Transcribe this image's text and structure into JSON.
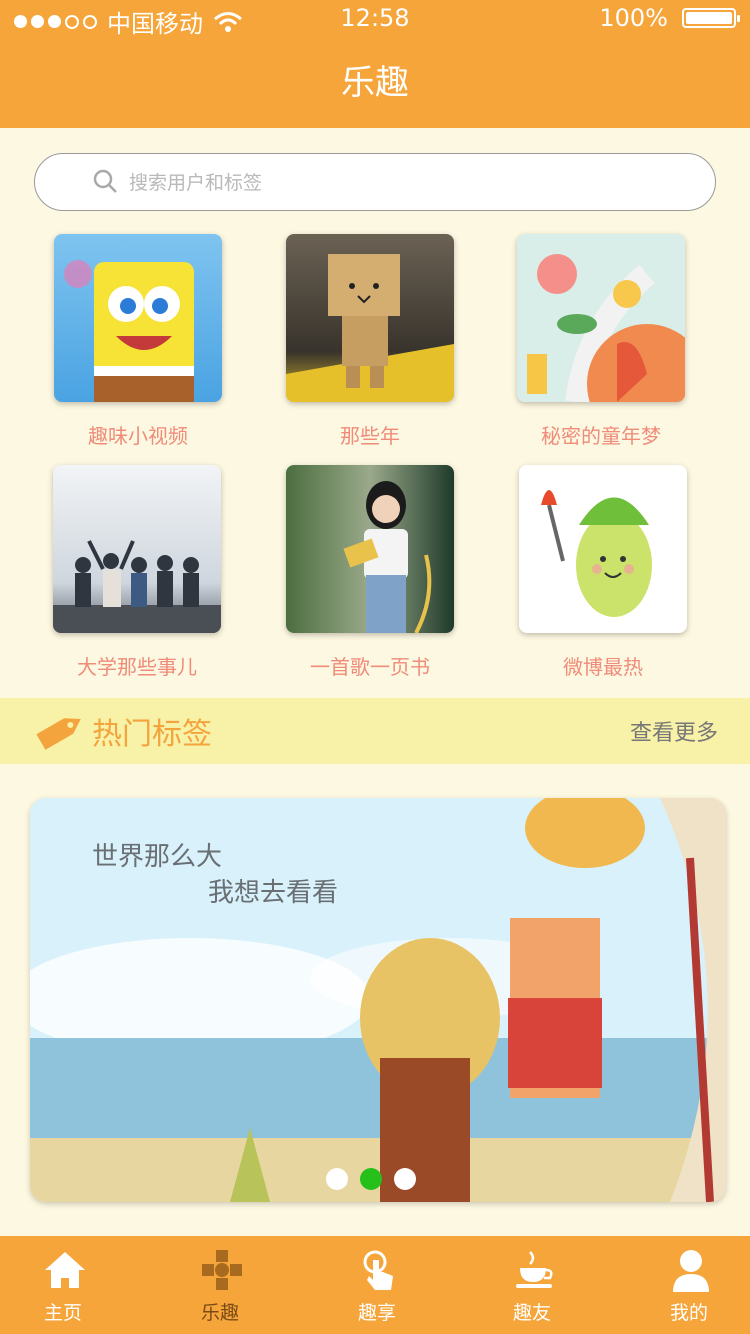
{
  "status_bar": {
    "carrier": "中国移动",
    "time": "12:58",
    "battery": "100%",
    "signal_icon": "signal-dots-icon",
    "wifi_icon": "wifi-icon",
    "battery_level": 1.0
  },
  "header": {
    "title": "乐趣"
  },
  "search": {
    "placeholder": "搜索用户和标签",
    "icon": "search-icon"
  },
  "categories": [
    {
      "label": "趣味小视频"
    },
    {
      "label": "那些年"
    },
    {
      "label": "秘密的童年梦"
    },
    {
      "label": "大学那些事儿"
    },
    {
      "label": "一首歌一页书"
    },
    {
      "label": "微博最热"
    }
  ],
  "hot_tags": {
    "title": "热门标签",
    "more": "查看更多",
    "icon": "tag-icon"
  },
  "banner": {
    "line1": "世界那么大",
    "line2": "我想去看看",
    "active_page": 2,
    "page_count": 3
  },
  "tabs": [
    {
      "label": "主页",
      "icon": "home-icon"
    },
    {
      "label": "乐趣",
      "icon": "fun-icon",
      "active": true
    },
    {
      "label": "趣享",
      "icon": "touch-icon"
    },
    {
      "label": "趣友",
      "icon": "coffee-icon"
    },
    {
      "label": "我的",
      "icon": "user-icon"
    }
  ],
  "colors": {
    "accent": "#f5a53a",
    "background": "#fdf8e1",
    "caption": "#ef8c7a",
    "tagbar": "#f8f1a8",
    "pager_active": "#26c01a",
    "tab_active": "#7a4a16"
  }
}
